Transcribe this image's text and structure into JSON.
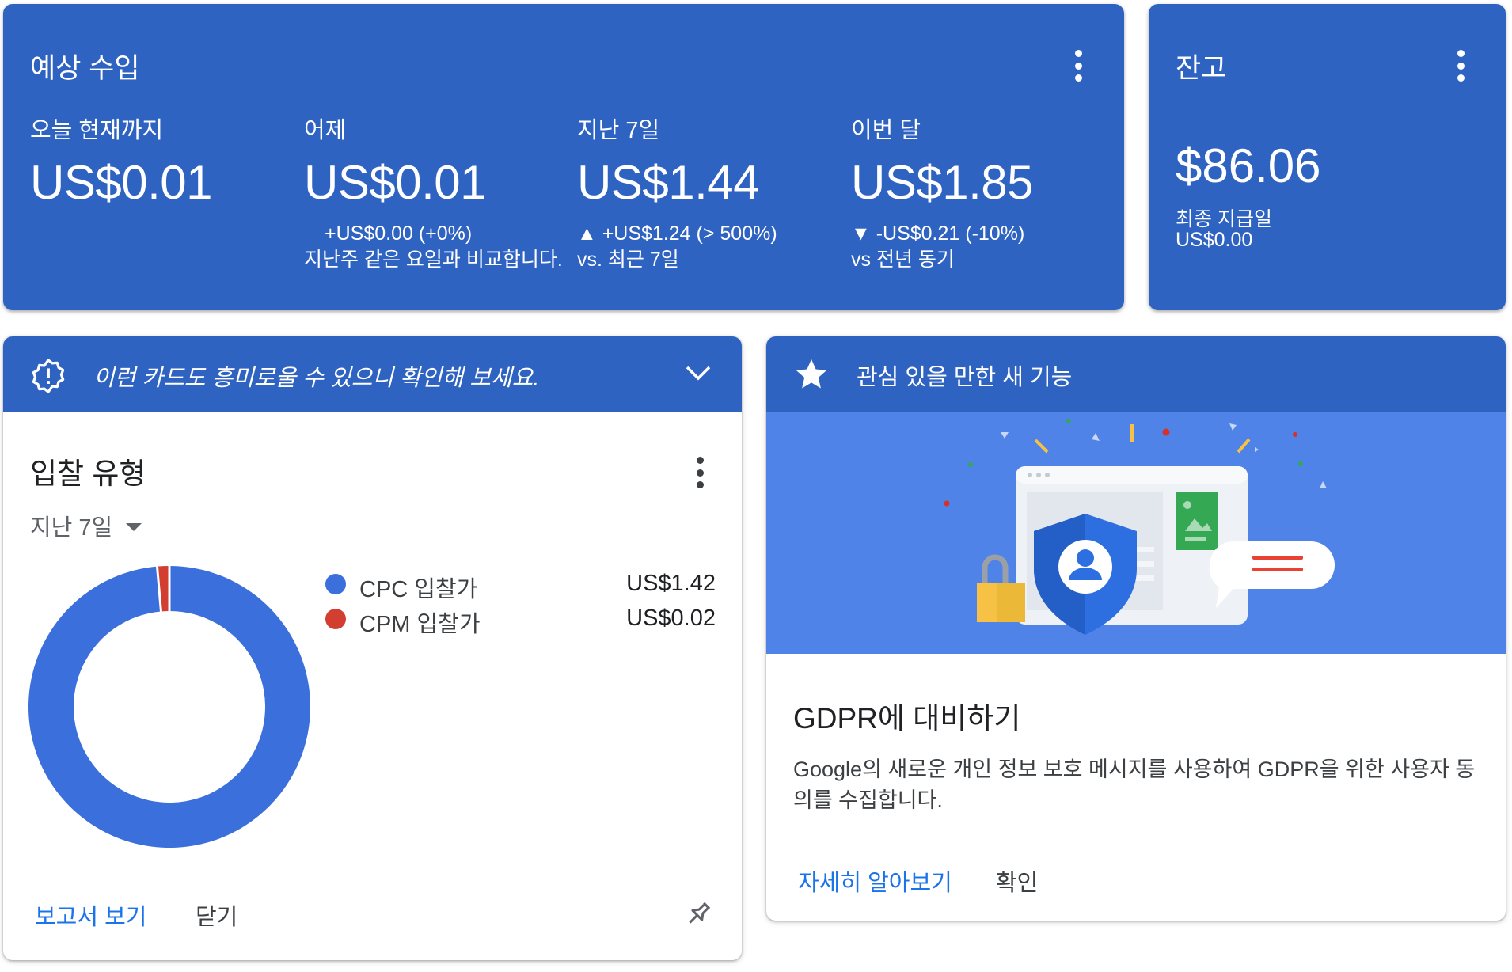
{
  "earnings": {
    "title": "예상 수입",
    "columns": [
      {
        "label": "오늘 현재까지",
        "value": "US$0.01",
        "change": "",
        "compare": ""
      },
      {
        "label": "어제",
        "value": "US$0.01",
        "change": "+US$0.00 (+0%)",
        "compare": "지난주 같은 요일과 비교합니다."
      },
      {
        "label": "지난 7일",
        "value": "US$1.44",
        "change": "▲ +US$1.24 (> 500%)",
        "compare": "vs. 최근 7일"
      },
      {
        "label": "이번 달",
        "value": "US$1.85",
        "change": "▼ -US$0.21 (-10%)",
        "compare": "vs 전년 동기"
      }
    ]
  },
  "balance": {
    "title": "잔고",
    "value": "$86.06",
    "last_payment_label": "최종 지급일",
    "last_payment_value": "US$0.00"
  },
  "suggestion": {
    "header": "이런 카드도 흥미로울 수 있으니 확인해 보세요.",
    "card_title": "입찰 유형",
    "period": "지난 7일",
    "report_link": "보고서 보기",
    "close": "닫기"
  },
  "chart_data": {
    "type": "pie",
    "labels": [
      "CPC 입찰가",
      "CPM 입찰가"
    ],
    "values": [
      1.42,
      0.02
    ],
    "display_values": [
      "US$1.42",
      "US$0.02"
    ],
    "colors": [
      "#3b6fdc",
      "#d23f31"
    ]
  },
  "feature": {
    "header": "관심 있을 만한 새 기능",
    "title": "GDPR에 대비하기",
    "body_line1": "Google의 새로운 개인 정보 보호 메시지를 사용하여 GDPR을 위한 사용자 동",
    "body_line2": "의를 수집합니다.",
    "learn_more": "자세히 알아보기",
    "confirm": "확인"
  }
}
